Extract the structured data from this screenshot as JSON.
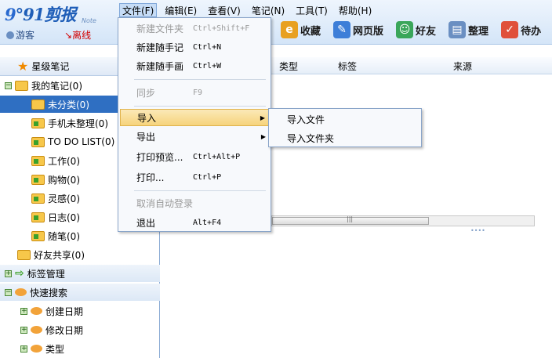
{
  "app": {
    "logo_text": "91剪报",
    "logo_sub": "Note",
    "user": "游客",
    "status": "离线"
  },
  "menu": [
    {
      "label": "文件(F)",
      "key": "file"
    },
    {
      "label": "编辑(E)",
      "key": "edit"
    },
    {
      "label": "查看(V)",
      "key": "view"
    },
    {
      "label": "笔记(N)",
      "key": "note"
    },
    {
      "label": "工具(T)",
      "key": "tools"
    },
    {
      "label": "帮助(H)",
      "key": "help"
    }
  ],
  "toolbar": [
    {
      "label": "收藏",
      "icon": "favorite-icon",
      "color": "#e8a020"
    },
    {
      "label": "网页版",
      "icon": "web-icon",
      "color": "#3d7ed8"
    },
    {
      "label": "好友",
      "icon": "friends-icon",
      "color": "#3aa65a"
    },
    {
      "label": "整理",
      "icon": "organize-icon",
      "color": "#6a8fc2"
    },
    {
      "label": "待办",
      "icon": "todo-icon",
      "color": "#e0503a"
    }
  ],
  "tree": {
    "starred": "星级笔记",
    "my_notes": "我的笔记(0)",
    "items": [
      {
        "label": "未分类(0)"
      },
      {
        "label": "手机未整理(0)"
      },
      {
        "label": "TO DO LIST(0)"
      },
      {
        "label": "工作(0)"
      },
      {
        "label": "购物(0)"
      },
      {
        "label": "灵感(0)"
      },
      {
        "label": "日志(0)"
      },
      {
        "label": "随笔(0)"
      }
    ],
    "shared": "好友共享(0)",
    "tag_manage": "标签管理",
    "quick_search": "快速搜索",
    "search_items": [
      {
        "label": "创建日期"
      },
      {
        "label": "修改日期"
      },
      {
        "label": "类型"
      }
    ]
  },
  "grid": {
    "columns": [
      "类型",
      "标签",
      "来源"
    ]
  },
  "file_menu": {
    "items": [
      {
        "label": "新建文件夹",
        "shortcut": "Ctrl+Shift+F"
      },
      {
        "label": "新建随手记",
        "shortcut": "Ctrl+N"
      },
      {
        "label": "新建随手画",
        "shortcut": "Ctrl+W"
      },
      {
        "label": "同步",
        "shortcut": "F9"
      },
      {
        "label": "导入",
        "shortcut": ""
      },
      {
        "label": "导出",
        "shortcut": ""
      },
      {
        "label": "打印预览...",
        "shortcut": "Ctrl+Alt+P"
      },
      {
        "label": "打印...",
        "shortcut": "Ctrl+P"
      },
      {
        "label": "取消自动登录",
        "shortcut": ""
      },
      {
        "label": "退出",
        "shortcut": "Alt+F4"
      }
    ]
  },
  "import_submenu": {
    "items": [
      "导入文件",
      "导入文件夹"
    ]
  }
}
